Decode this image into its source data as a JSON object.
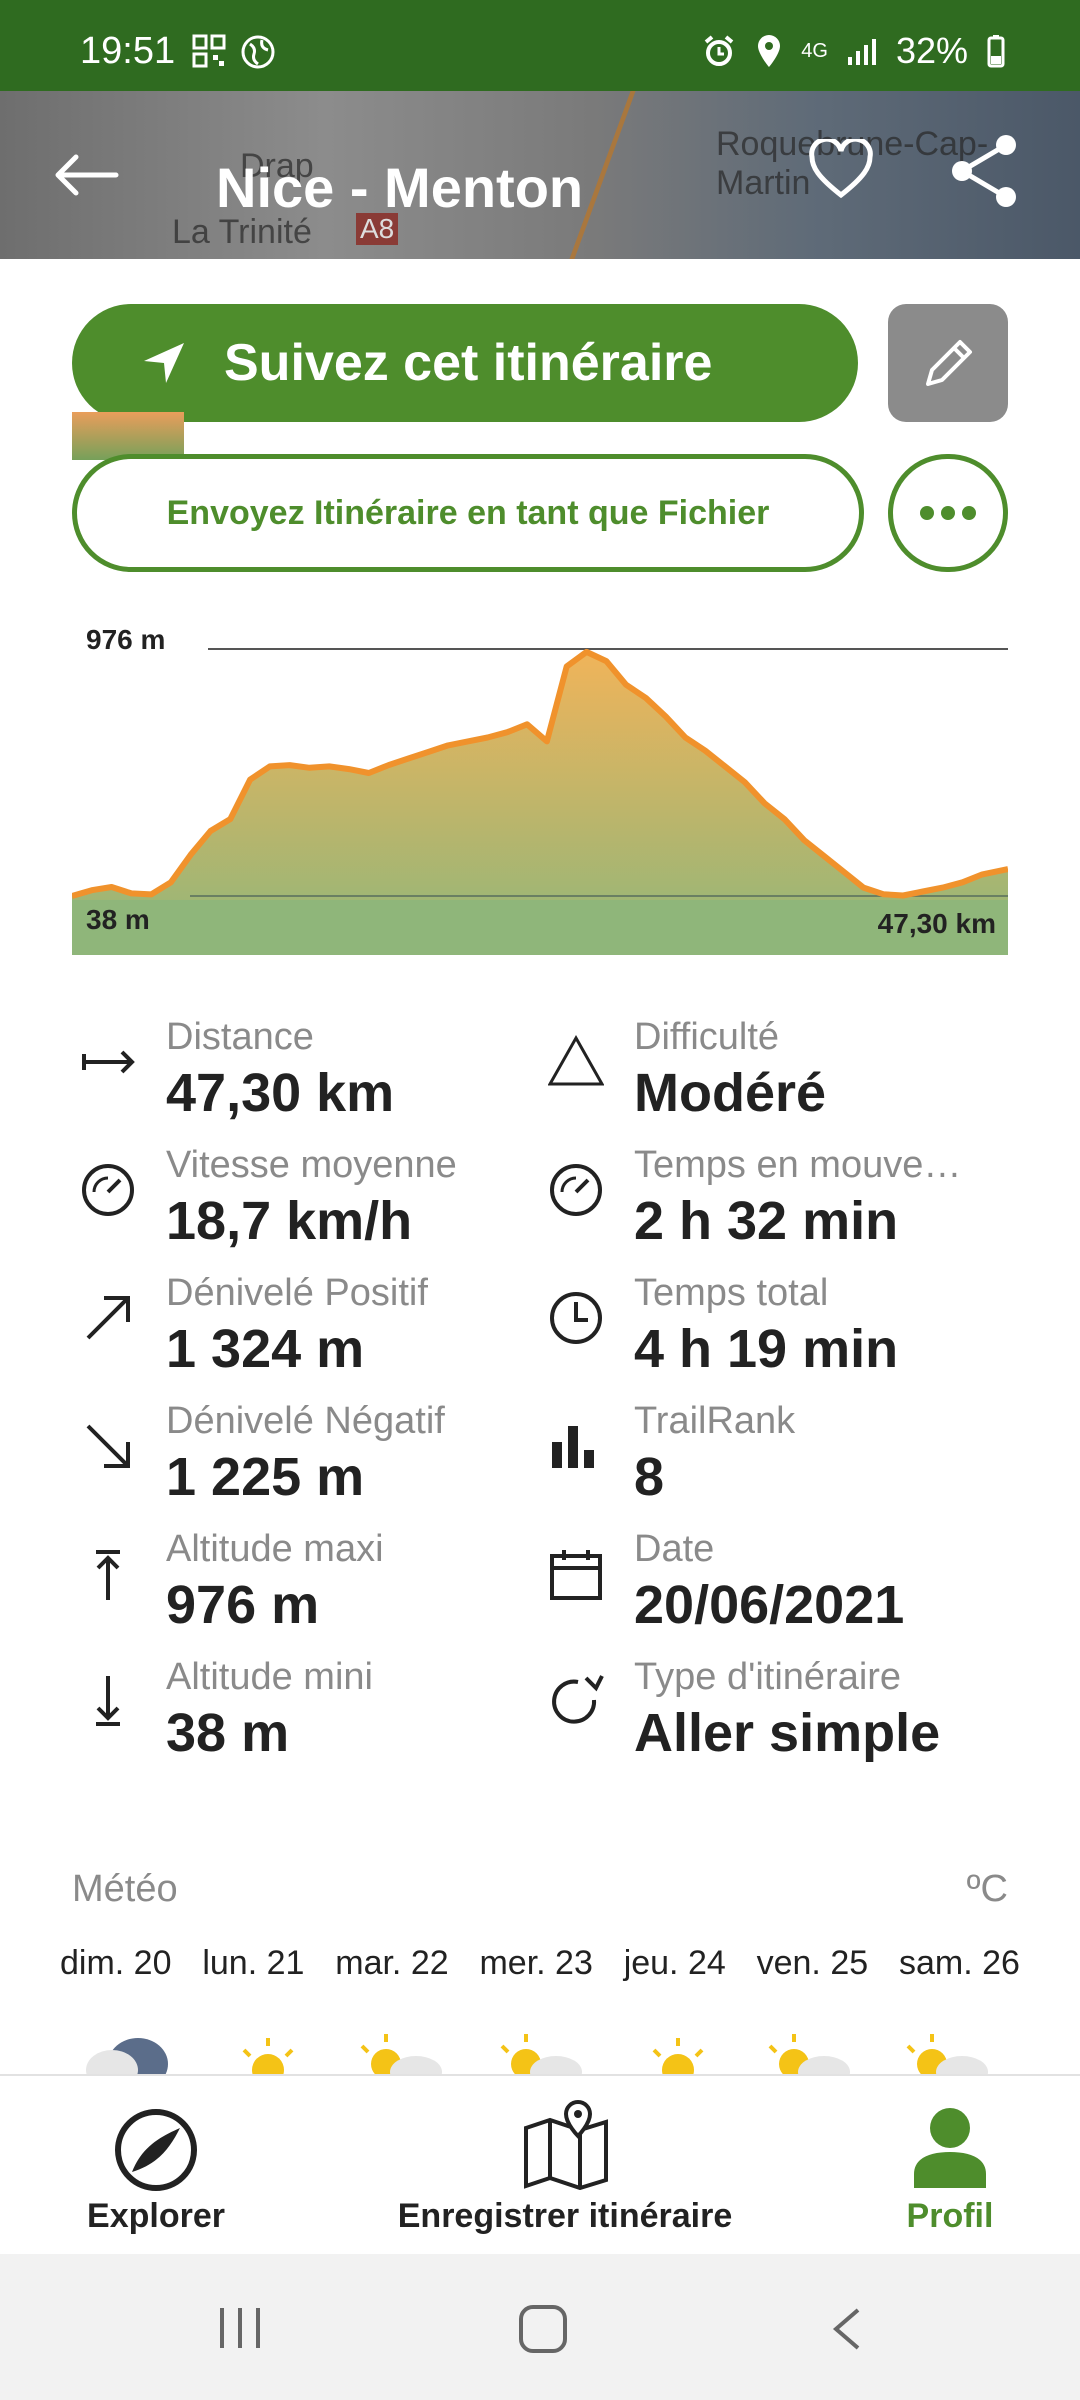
{
  "status_bar": {
    "time": "19:51",
    "network": "4G",
    "battery": "32%"
  },
  "header": {
    "title": "Nice - Menton",
    "map_labels": [
      "Drap",
      "La Trinité",
      "A8",
      "Roquebrune-Cap-Martin"
    ]
  },
  "actions": {
    "follow_label": "Suivez cet itinéraire",
    "send_file_label": "Envoyez Itinéraire en tant que Fichier"
  },
  "elevation_chart": {
    "max_label": "976 m",
    "min_label": "38 m",
    "distance_label": "47,30 km"
  },
  "chart_data": {
    "type": "area",
    "x": [
      0,
      1,
      2,
      3,
      4,
      5,
      6,
      7,
      8,
      9,
      10,
      11,
      12,
      13,
      14,
      15,
      16,
      17,
      18,
      19,
      20,
      21,
      22,
      23,
      24,
      25,
      26,
      27,
      28,
      29,
      30,
      31,
      32,
      33,
      34,
      35,
      36,
      37,
      38,
      39,
      40,
      41,
      42,
      43,
      44,
      45,
      46,
      47.3
    ],
    "y": [
      38,
      60,
      72,
      48,
      44,
      90,
      195,
      285,
      330,
      480,
      530,
      535,
      525,
      530,
      520,
      505,
      535,
      560,
      585,
      610,
      625,
      640,
      660,
      690,
      625,
      910,
      965,
      930,
      840,
      790,
      720,
      640,
      590,
      530,
      470,
      390,
      330,
      250,
      190,
      130,
      70,
      45,
      40,
      55,
      70,
      90,
      120,
      140
    ],
    "xlim": [
      0,
      47.3
    ],
    "ylim": [
      38,
      976
    ],
    "unit_x": "km",
    "unit_y": "m"
  },
  "stats_left": [
    {
      "label": "Distance",
      "value": "47,30 km",
      "icon": "arrow-horizontal-icon"
    },
    {
      "label": "Vitesse moyenne",
      "value": "18,7 km/h",
      "icon": "speedometer-icon"
    },
    {
      "label": "Dénivelé Positif",
      "value": "1 324 m",
      "icon": "arrow-up-right-icon"
    },
    {
      "label": "Dénivelé Négatif",
      "value": "1 225 m",
      "icon": "arrow-down-right-icon"
    },
    {
      "label": "Altitude maxi",
      "value": "976 m",
      "icon": "altitude-max-icon"
    },
    {
      "label": "Altitude mini",
      "value": "38 m",
      "icon": "altitude-min-icon"
    }
  ],
  "stats_right": [
    {
      "label": "Difficulté",
      "value": "Modéré",
      "icon": "triangle-icon"
    },
    {
      "label": "Temps en mouve…",
      "value": "2 h 32 min",
      "icon": "speedometer-icon"
    },
    {
      "label": "Temps total",
      "value": "4 h 19 min",
      "icon": "clock-icon"
    },
    {
      "label": "TrailRank",
      "value": "8",
      "icon": "bar-chart-icon"
    },
    {
      "label": "Date",
      "value": "20/06/2021",
      "icon": "calendar-icon"
    },
    {
      "label": "Type d'itinéraire",
      "value": "Aller simple",
      "icon": "circular-arrow-icon"
    }
  ],
  "weather": {
    "title": "Météo",
    "unit": "ºC",
    "days": [
      "dim. 20",
      "lun. 21",
      "mar. 22",
      "mer. 23",
      "jeu. 24",
      "ven. 25",
      "sam. 26"
    ],
    "icons": [
      "cloudy-icon",
      "sun-icon",
      "sun-cloud-icon",
      "sun-cloud-icon",
      "sun-icon",
      "sun-cloud-icon",
      "sun-cloud-icon"
    ]
  },
  "bottom_nav": {
    "items": [
      {
        "label": "Explorer"
      },
      {
        "label": "Enregistrer itinéraire"
      },
      {
        "label": "Profil"
      }
    ],
    "active_color": "#4e8d2c"
  },
  "colors": {
    "status_bar": "#2f6b20",
    "brand_green": "#4e8d2c",
    "chart_line": "#f0922c"
  }
}
